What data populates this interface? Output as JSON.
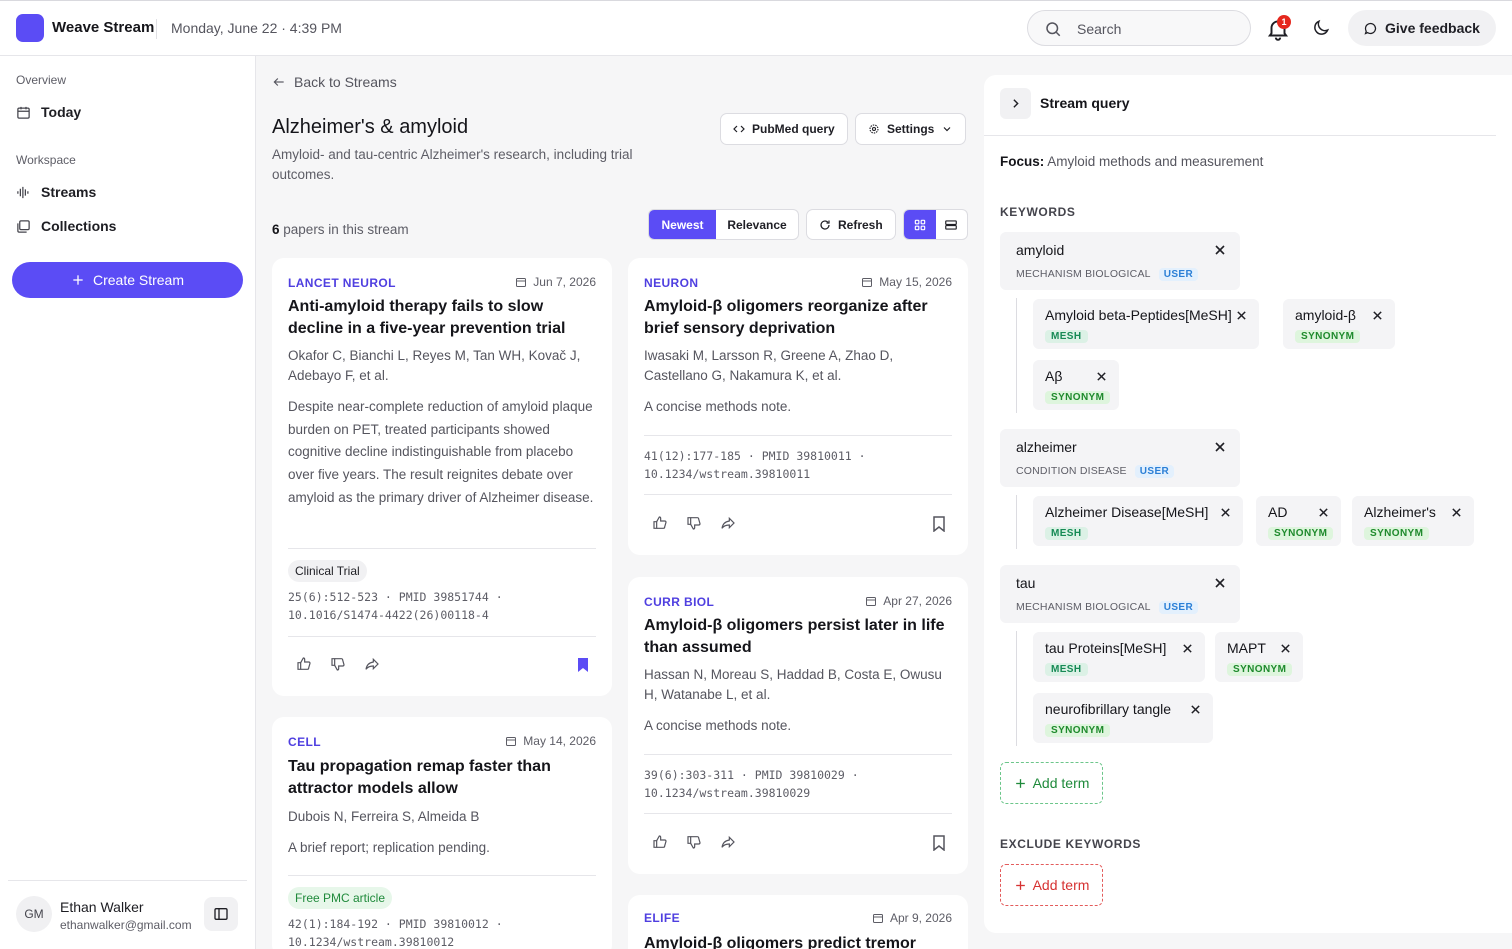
{
  "header": {
    "brand": "Weave Stream",
    "datetime": "Monday, June 22 · 4:39 PM",
    "search_placeholder": "Search",
    "notification_count": "1",
    "feedback_label": "Give feedback"
  },
  "sidebar": {
    "overview_label": "Overview",
    "today_label": "Today",
    "workspace_label": "Workspace",
    "streams_label": "Streams",
    "collections_label": "Collections",
    "create_label": "Create Stream",
    "user": {
      "initials": "GM",
      "name": "Ethan Walker",
      "email": "ethanwalker@gmail.com"
    }
  },
  "main": {
    "back_label": "Back to Streams",
    "title": "Alzheimer's & amyloid",
    "description": "Amyloid- and tau-centric Alzheimer's research, including trial outcomes.",
    "pubmed_label": "PubMed query",
    "settings_label": "Settings",
    "papers_count": "6",
    "papers_suffix": "papers in this stream",
    "sort_newest": "Newest",
    "sort_relevance": "Relevance",
    "refresh_label": "Refresh",
    "cards": [
      {
        "journal": "LANCET NEUROL",
        "date": "Jun 7, 2026",
        "title": "Anti-amyloid therapy fails to slow decline in a five-year prevention trial",
        "authors": "Okafor C, Bianchi L, Reyes M, Tan WH, Kovač J, Adebayo F, et al.",
        "abstract": "Despite near-complete reduction of amyloid plaque burden on PET, treated participants showed cognitive decline indistinguishable from placebo over five years. The result reignites debate over amyloid as the primary driver of Alzheimer disease.",
        "tag": "Clinical Trial",
        "meta1": "25(6):512-523 · PMID 39851744 ·",
        "meta2": "10.1016/S1474-4422(26)00118-4"
      },
      {
        "journal": "NEURON",
        "date": "May 15, 2026",
        "title": "Amyloid-β oligomers reorganize after brief sensory deprivation",
        "authors": "Iwasaki M, Larsson R, Greene A, Zhao D, Castellano G, Nakamura K, et al.",
        "abstract": "A concise methods note.",
        "meta1": "41(12):177-185 · PMID 39810011 ·",
        "meta2": "10.1234/wstream.39810011"
      },
      {
        "journal": "CURR BIOL",
        "date": "Apr 27, 2026",
        "title": "Amyloid-β oligomers persist later in life than assumed",
        "authors": "Hassan N, Moreau S, Haddad B, Costa E, Owusu H, Watanabe L, et al.",
        "abstract": "A concise methods note.",
        "meta1": "39(6):303-311 · PMID 39810029 ·",
        "meta2": "10.1234/wstream.39810029"
      },
      {
        "journal": "CELL",
        "date": "May 14, 2026",
        "title": "Tau propagation remap faster than attractor models allow",
        "authors": "Dubois N, Ferreira S, Almeida B",
        "abstract": "A brief report; replication pending.",
        "tag": "Free PMC article",
        "meta1": "42(1):184-192 · PMID 39810012 ·",
        "meta2": "10.1234/wstream.39810012"
      },
      {
        "journal": "ELIFE",
        "date": "Apr 9, 2026",
        "title": "Amyloid-β oligomers predict tremor"
      }
    ]
  },
  "panel": {
    "title": "Stream query",
    "focus_label": "Focus:",
    "focus_value": "Amyloid methods and measurement",
    "keywords_label": "KEYWORDS",
    "exclude_label": "EXCLUDE KEYWORDS",
    "add_term_label": "Add term",
    "keywords": [
      {
        "name": "amyloid",
        "type": "MECHANISM BIOLOGICAL",
        "source": "USER",
        "terms": [
          {
            "name": "Amyloid beta-Peptides[MeSH]",
            "tag": "MESH"
          },
          {
            "name": "amyloid-β",
            "tag": "SYNONYM"
          },
          {
            "name": "Aβ",
            "tag": "SYNONYM"
          }
        ]
      },
      {
        "name": "alzheimer",
        "type": "CONDITION DISEASE",
        "source": "USER",
        "terms": [
          {
            "name": "Alzheimer Disease[MeSH]",
            "tag": "MESH"
          },
          {
            "name": "AD",
            "tag": "SYNONYM"
          },
          {
            "name": "Alzheimer's",
            "tag": "SYNONYM"
          }
        ]
      },
      {
        "name": "tau",
        "type": "MECHANISM BIOLOGICAL",
        "source": "USER",
        "terms": [
          {
            "name": "tau Proteins[MeSH]",
            "tag": "MESH"
          },
          {
            "name": "MAPT",
            "tag": "SYNONYM"
          },
          {
            "name": "neurofibrillary tangle",
            "tag": "SYNONYM"
          }
        ]
      }
    ]
  },
  "colors": {
    "accent": "#5b4cf5",
    "journal": "#4f3fe0"
  }
}
